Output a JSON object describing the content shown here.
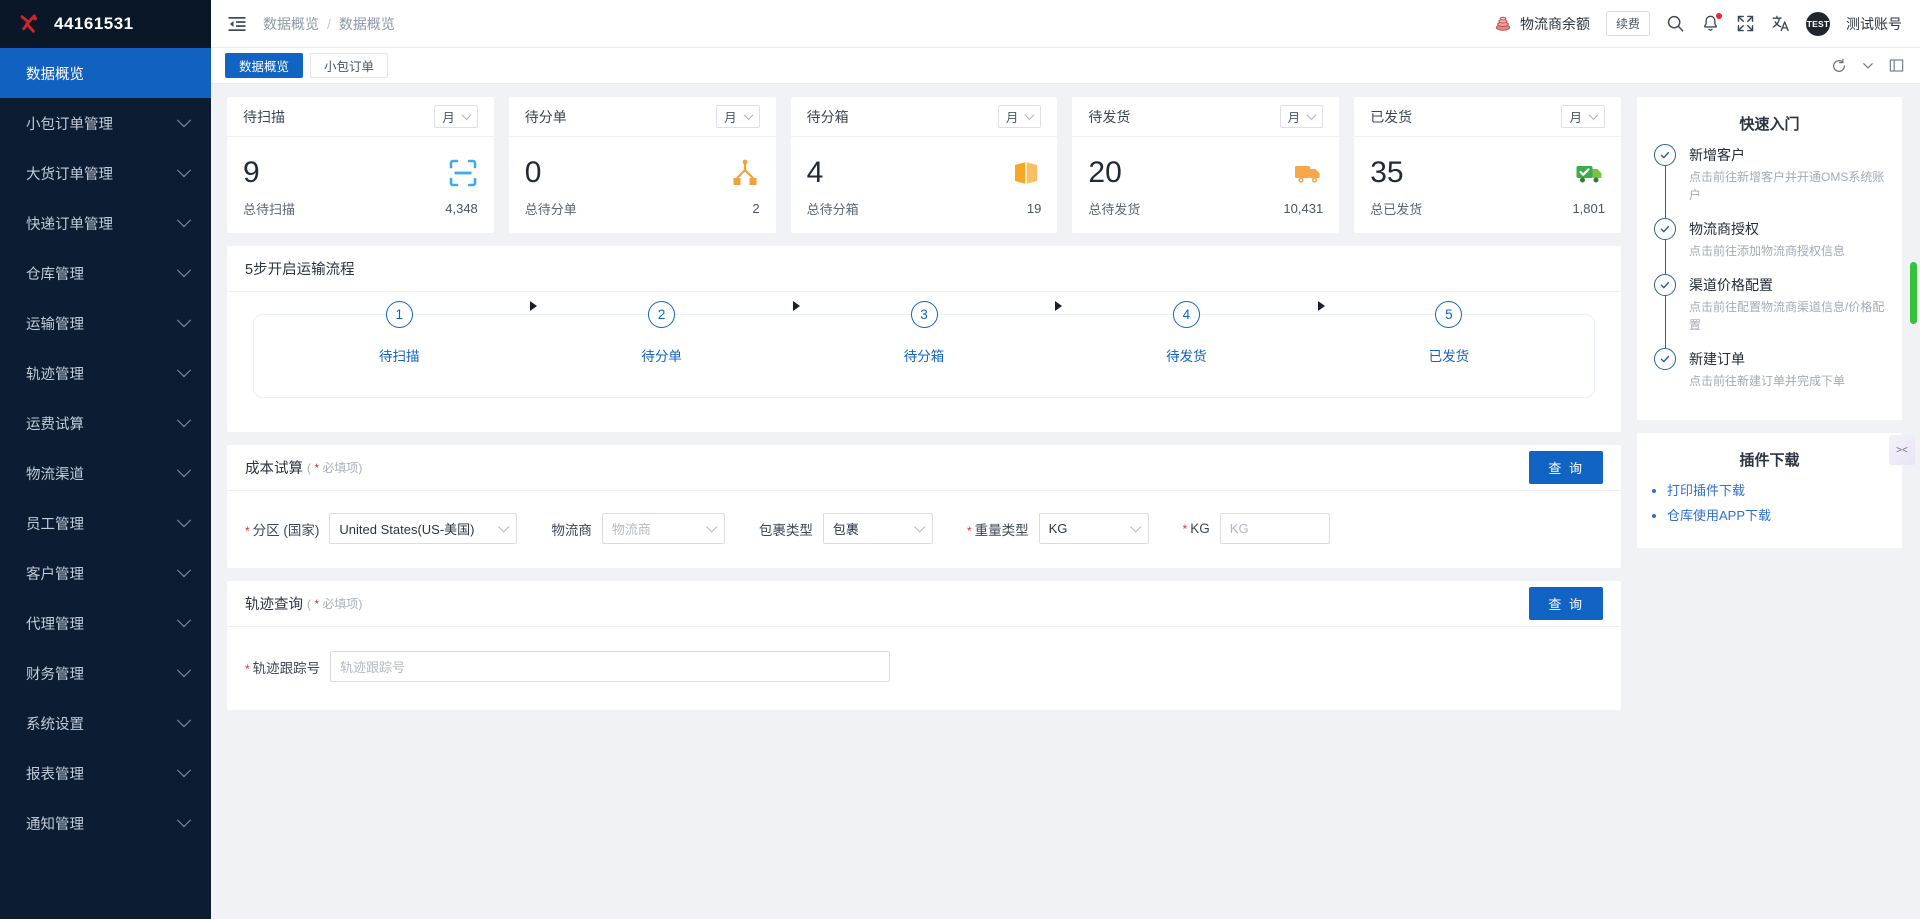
{
  "sidebar": {
    "logo_text": "44161531",
    "items": [
      {
        "label": "数据概览",
        "active": true,
        "expandable": false
      },
      {
        "label": "小包订单管理",
        "active": false,
        "expandable": true
      },
      {
        "label": "大货订单管理",
        "active": false,
        "expandable": true
      },
      {
        "label": "快递订单管理",
        "active": false,
        "expandable": true
      },
      {
        "label": "仓库管理",
        "active": false,
        "expandable": true
      },
      {
        "label": "运输管理",
        "active": false,
        "expandable": true
      },
      {
        "label": "轨迹管理",
        "active": false,
        "expandable": true
      },
      {
        "label": "运费试算",
        "active": false,
        "expandable": true
      },
      {
        "label": "物流渠道",
        "active": false,
        "expandable": true
      },
      {
        "label": "员工管理",
        "active": false,
        "expandable": true
      },
      {
        "label": "客户管理",
        "active": false,
        "expandable": true
      },
      {
        "label": "代理管理",
        "active": false,
        "expandable": true
      },
      {
        "label": "财务管理",
        "active": false,
        "expandable": true
      },
      {
        "label": "系统设置",
        "active": false,
        "expandable": true
      },
      {
        "label": "报表管理",
        "active": false,
        "expandable": true
      },
      {
        "label": "通知管理",
        "active": false,
        "expandable": true
      }
    ]
  },
  "topbar": {
    "breadcrumb": [
      "数据概览",
      "数据概览"
    ],
    "breadcrumb_sep": "/",
    "balance_label": "物流商余额",
    "renew_label": "续费",
    "avatar_text": "TEST",
    "user_name": "测试账号"
  },
  "tabs": [
    {
      "label": "数据概览",
      "active": true
    },
    {
      "label": "小包订单",
      "active": false
    }
  ],
  "stats": [
    {
      "title": "待扫描",
      "period": "月",
      "value": "9",
      "total_label": "总待扫描",
      "total_value": "4,348",
      "icon": "scan-icon",
      "color": "#3faaf0"
    },
    {
      "title": "待分单",
      "period": "月",
      "value": "0",
      "total_label": "总待分单",
      "total_value": "2",
      "icon": "split-icon",
      "color": "#f0a23c"
    },
    {
      "title": "待分箱",
      "period": "月",
      "value": "4",
      "total_label": "总待分箱",
      "total_value": "19",
      "icon": "box-icon",
      "color": "#f5a623"
    },
    {
      "title": "待发货",
      "period": "月",
      "value": "20",
      "total_label": "总待发货",
      "total_value": "10,431",
      "icon": "truck-icon",
      "color": "#f7a64a"
    },
    {
      "title": "已发货",
      "period": "月",
      "value": "35",
      "total_label": "总已发货",
      "total_value": "1,801",
      "icon": "truck-ok-icon",
      "color": "#3bad4a"
    }
  ],
  "steps_panel": {
    "title": "5步开启运输流程",
    "steps": [
      {
        "num": "1",
        "label": "待扫描"
      },
      {
        "num": "2",
        "label": "待分单"
      },
      {
        "num": "3",
        "label": "待分箱"
      },
      {
        "num": "4",
        "label": "待发货"
      },
      {
        "num": "5",
        "label": "已发货"
      }
    ]
  },
  "cost_form": {
    "title": "成本试算",
    "required_note": "必填项",
    "query_button": "查 询",
    "country_label": "分区 (国家)",
    "country_value": "United States(US-美国)",
    "carrier_label": "物流商",
    "carrier_placeholder": "物流商",
    "package_label": "包裹类型",
    "package_value": "包裹",
    "weight_type_label": "重量类型",
    "weight_type_value": "KG",
    "kg_label": "KG",
    "kg_placeholder": "KG"
  },
  "track_form": {
    "title": "轨迹查询",
    "required_note": "必填项",
    "query_button": "查 询",
    "tracking_label": "轨迹跟踪号",
    "tracking_placeholder": "轨迹跟踪号"
  },
  "quick_start": {
    "title": "快速入门",
    "items": [
      {
        "title": "新增客户",
        "desc": "点击前往新增客户并开通OMS系统账户"
      },
      {
        "title": "物流商授权",
        "desc": "点击前往添加物流商授权信息"
      },
      {
        "title": "渠道价格配置",
        "desc": "点击前往配置物流商渠道信息/价格配置"
      },
      {
        "title": "新建订单",
        "desc": "点击前往新建订单并完成下单"
      }
    ]
  },
  "plugin_download": {
    "title": "插件下载",
    "links": [
      "打印插件下载",
      "仓库使用APP下载"
    ]
  }
}
